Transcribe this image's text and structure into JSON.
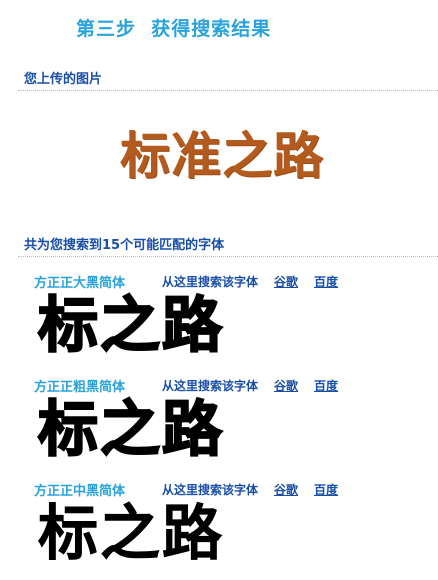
{
  "step_title": "第三步  获得搜索结果",
  "uploaded_heading": "您上传的图片",
  "uploaded_image_text": "标准之路",
  "results_heading": "共为您搜索到15个可能匹配的字体",
  "from_here_label": "从这里搜索该字体",
  "google_label": "谷歌",
  "baidu_label": "百度",
  "results": [
    {
      "font_name": "方正正大黑简体",
      "preview": "标之路"
    },
    {
      "font_name": "方正正粗黑简体",
      "preview": "标之路"
    },
    {
      "font_name": "方正正中黑简体",
      "preview": "标之路"
    }
  ],
  "colors": {
    "title": "#2aa3dc",
    "heading": "#1a4fa8",
    "uploaded_text": "#b35a1e"
  }
}
